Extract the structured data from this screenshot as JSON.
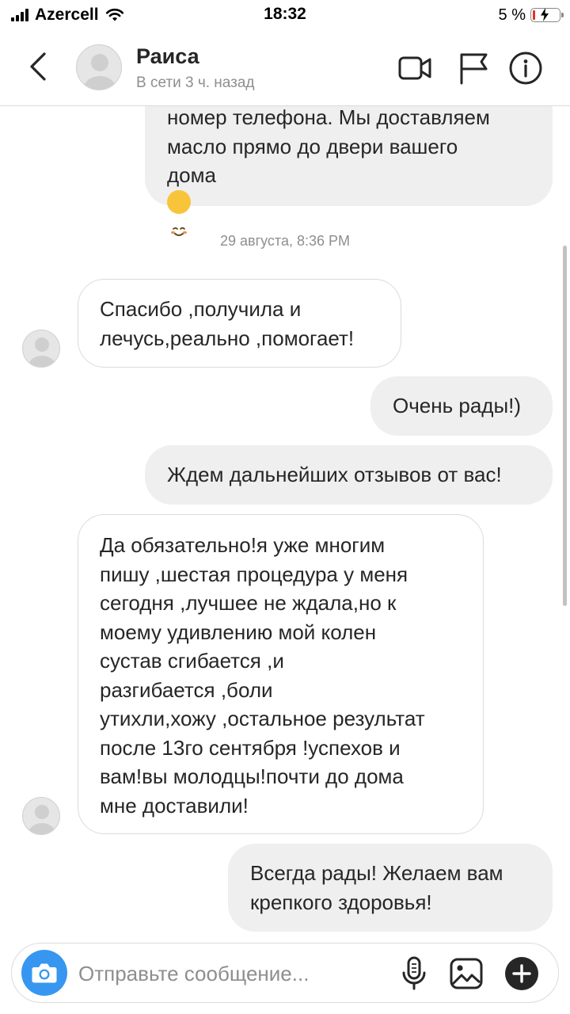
{
  "status_bar": {
    "carrier": "Azercell",
    "time": "18:32",
    "battery_percent": "5 %",
    "battery_level": 0.05
  },
  "header": {
    "contact_name": "Раиса",
    "contact_status": "В сети 3 ч. назад",
    "icons": [
      "back-chevron-icon",
      "video-call-icon",
      "flag-icon",
      "info-icon"
    ]
  },
  "messages": [
    {
      "from": "me",
      "text": "номер телефона. Мы доставляем\nмасло прямо до двери вашего\nдома",
      "emoji": "smiling-face-emoji"
    },
    {
      "from": "them",
      "text": "Спасибо ,получила и\nлечусь,реально ,помогает!"
    },
    {
      "from": "me",
      "text": "Очень рады!)"
    },
    {
      "from": "me",
      "text": "Ждем дальнейших отзывов от вас!"
    },
    {
      "from": "them",
      "text": "Да обязательно!я уже многим\nпишу ,шестая процедура у меня\nсегодня ,лучшее не ждала,но к\nмоему удивлению мой колен\nсустав сгибается ,и\nразгибается ,боли\nутихли,хожу ,остальное результат\nпосле 13го сентября !успехов и\nвам!вы молодцы!почти до дома\nмне доставили!"
    },
    {
      "from": "me",
      "text": "Всегда рады! Желаем вам\nкрепкого здоровья!"
    }
  ],
  "timestamp": "29 августа, 8:36 PM",
  "composer": {
    "placeholder": "Отправьте сообщение...",
    "icons": [
      "camera-icon",
      "microphone-icon",
      "gallery-icon",
      "add-icon"
    ],
    "accent_color": "#3797f0"
  },
  "colors": {
    "outgoing_bubble": "#efefef",
    "incoming_border": "#dbdbdb",
    "secondary_text": "#8e8e8e"
  }
}
